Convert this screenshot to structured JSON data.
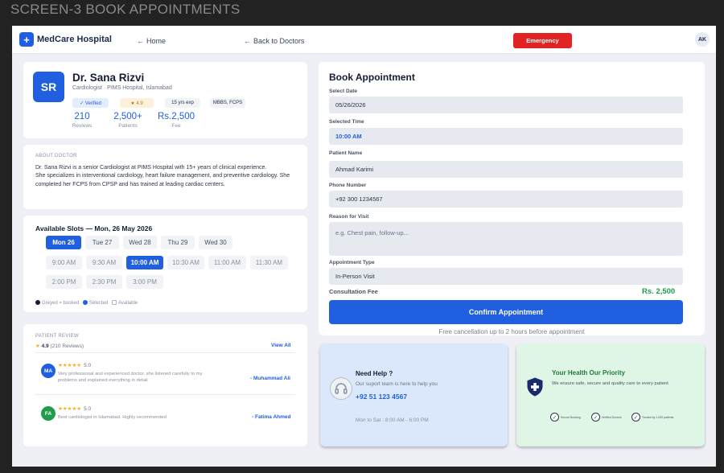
{
  "screen_label": "SCREEN-3 BOOK APPOINTMENTS",
  "header": {
    "logo_glyph": "+",
    "brand": "MedCare Hospital",
    "home": "Home",
    "back": "Back to Doctors",
    "emergency": "Emergency",
    "avatar": "AK"
  },
  "doctor": {
    "initials": "SR",
    "name": "Dr. Sana Rizvi",
    "subtitle": "Cardiologist · PIMS Hospital, Islamabad",
    "badges": {
      "verified": "✓ Verified",
      "rating": "★ 4.9",
      "experience": "15 yrs exp",
      "degrees": "MBBS, FCPS"
    },
    "stats": [
      {
        "value": "210",
        "label": "Reviews"
      },
      {
        "value": "2,500+",
        "label": "Patients"
      },
      {
        "value": "Rs.2,500",
        "label": "Fee"
      }
    ]
  },
  "about": {
    "title": "ABOUT DOCTOR",
    "para1": "Dr. Sana Rizvi is a senior Cardiologist at PIMS Hospital with 15+ years of clinical experience.",
    "para2": "She specializes in interventional cardiology, heart failure management, and preventive cardiology. She completed her FCPS from CPSP and has trained at leading cardiac centers."
  },
  "slots": {
    "title": "Available Slots — Mon, 26 May 2026",
    "days": [
      "Mon 26",
      "Tue 27",
      "Wed 28",
      "Thu 29",
      "Wed 30"
    ],
    "times_row1": [
      "9:00 AM",
      "9:30 AM",
      "10:00 AM",
      "10:30 AM",
      "11:00 AM",
      "11:30 AM"
    ],
    "times_row2": [
      "2:00 PM",
      "2:30 PM",
      "3:00 PM"
    ],
    "selected_day_index": 0,
    "selected_time_index": 2,
    "legend": {
      "booked": "Greyed = booked",
      "selected": "Selected",
      "available": "Available"
    }
  },
  "reviews": {
    "title": "PATIENT REVIEW",
    "rating": "4.9",
    "count": "(210 Reviews)",
    "view_all": "View All",
    "items": [
      {
        "initials": "MA",
        "stars": "★★★★★",
        "score": "5.0",
        "text": "Very professional and experienced doctor, she listened carefully to my problems and explained everything in detail",
        "author": "- Muhammad Ali",
        "color": "#1f5fe0"
      },
      {
        "initials": "FA",
        "stars": "★★★★★",
        "score": "5.0",
        "text": "Best cardiologist in Islamabad. Highly recommended",
        "author": "- Fatima Ahmed",
        "color": "#1f9d4a"
      }
    ]
  },
  "booking": {
    "title": "Book Appointment",
    "date_label": "Select Date",
    "date_value": "05/26/2026",
    "time_label": "Selected Time",
    "time_value": "10:00 AM",
    "patient_label": "Patient Name",
    "patient_value": "Ahmad Karimi",
    "phone_label": "Phone Number",
    "phone_value": "+92 300 1234567",
    "reason_label": "Reason for Visit",
    "reason_placeholder": "e.g. Chest pain, follow-up...",
    "type_label": "Appointment Type",
    "type_value": "In-Person Visit",
    "fee_label": "Consultation Fee",
    "fee_value": "Rs. 2,500",
    "confirm": "Confirm Appointment",
    "note": "Free cancellation up to 2 hours before appointment"
  },
  "help": {
    "title": "Need Help ?",
    "subtitle": "Our suport team is here to help you",
    "phone": "+92 51 123 4567",
    "hours": "Mon to Sat : 8:00 AM - 6:00 PM",
    "icon": "headset-icon"
  },
  "priority": {
    "title": "Your Health Our Priority",
    "subtitle": "We ensure safe, secure and quality care to every patient",
    "icon": "shield-icon",
    "checks": [
      "Secure Booking",
      "Verified Doctors",
      "Trusted by 1,000 patients"
    ]
  },
  "colors": {
    "primary": "#1f5fe0",
    "danger": "#e02424",
    "success": "#1f9d4a",
    "star": "#f2b01e"
  }
}
